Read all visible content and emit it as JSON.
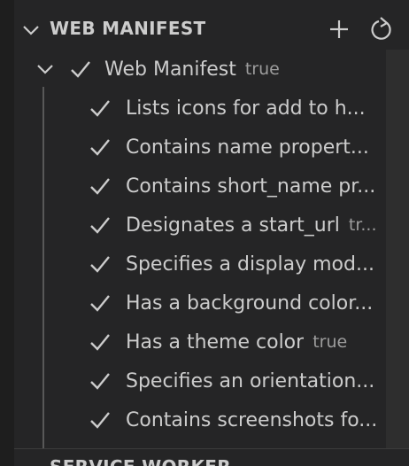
{
  "section": {
    "title": "WEB MANIFEST",
    "add_label": "Add",
    "refresh_label": "Refresh"
  },
  "group": {
    "label": "Web Manifest",
    "description": "true"
  },
  "items": [
    {
      "label": "Lists icons for add to h...",
      "description": ""
    },
    {
      "label": "Contains name propert...",
      "description": ""
    },
    {
      "label": "Contains short_name pr...",
      "description": ""
    },
    {
      "label": "Designates a start_url",
      "description": "tr..."
    },
    {
      "label": "Specifies a display mod...",
      "description": ""
    },
    {
      "label": "Has a background color...",
      "description": ""
    },
    {
      "label": "Has a theme color",
      "description": "true"
    },
    {
      "label": "Specifies an orientation...",
      "description": ""
    },
    {
      "label": "Contains screenshots fo...",
      "description": ""
    }
  ],
  "next_section": {
    "title": "SERVICE WORKER"
  },
  "colors": {
    "background": "#252526",
    "text": "#cccccc",
    "description": "#9d9d9d",
    "guide": "#585858"
  }
}
